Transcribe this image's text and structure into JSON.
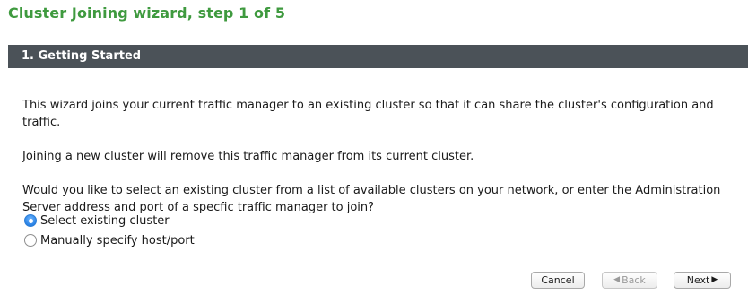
{
  "wizard": {
    "title": "Cluster Joining wizard, step 1 of 5",
    "section_title": "1. Getting Started"
  },
  "content": {
    "intro": "This wizard joins your current traffic manager to an existing cluster so that it can share the cluster's configuration and traffic.",
    "warning": "Joining a new cluster will remove this traffic manager from its current cluster.",
    "question": "Would you like to select an existing cluster from a list of available clusters on your network, or enter the Administration Server address and port of a specfic traffic manager to join?"
  },
  "options": [
    {
      "label": "Select existing cluster",
      "selected": true
    },
    {
      "label": "Manually specify host/port",
      "selected": false
    }
  ],
  "buttons": {
    "cancel": "Cancel",
    "back": "Back",
    "back_enabled": false,
    "next": "Next"
  },
  "colors": {
    "title": "#3f9a3f",
    "header_bg": "#4b5258",
    "radio_selected": "#2a83e6"
  },
  "icons": {
    "back": "left-triangle-icon",
    "next": "right-triangle-icon"
  }
}
